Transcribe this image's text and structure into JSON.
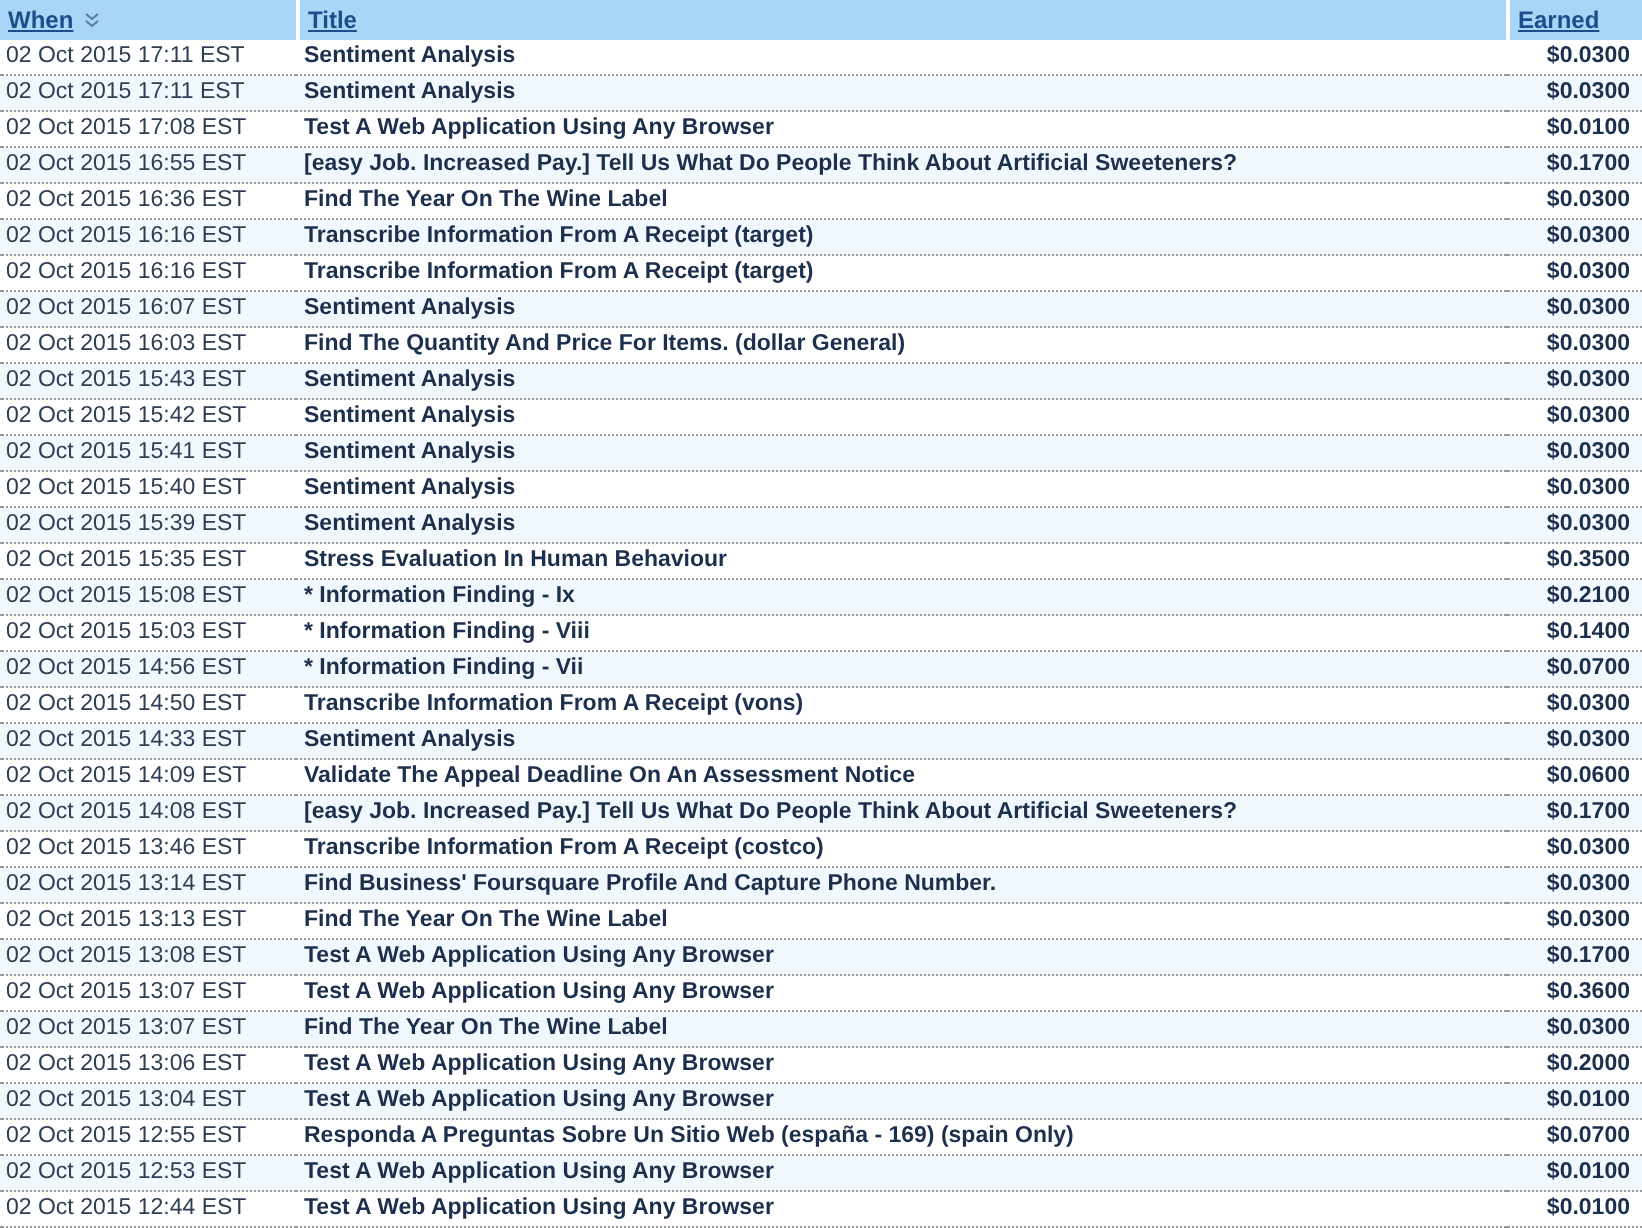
{
  "table": {
    "columns": [
      {
        "label": "When",
        "sorted": true
      },
      {
        "label": "Title",
        "sorted": false
      },
      {
        "label": "Earned",
        "sorted": false
      }
    ],
    "rows": [
      [
        "02 Oct 2015 17:11 EST",
        "Sentiment Analysis",
        "$0.0300"
      ],
      [
        "02 Oct 2015 17:11 EST",
        "Sentiment Analysis",
        "$0.0300"
      ],
      [
        "02 Oct 2015 17:08 EST",
        "Test A Web Application Using Any Browser",
        "$0.0100"
      ],
      [
        "02 Oct 2015 16:55 EST",
        "[easy Job. Increased Pay.] Tell Us What Do People Think About Artificial Sweeteners?",
        "$0.1700"
      ],
      [
        "02 Oct 2015 16:36 EST",
        "Find The Year On The Wine Label",
        "$0.0300"
      ],
      [
        "02 Oct 2015 16:16 EST",
        "Transcribe Information From A Receipt (target)",
        "$0.0300"
      ],
      [
        "02 Oct 2015 16:16 EST",
        "Transcribe Information From A Receipt (target)",
        "$0.0300"
      ],
      [
        "02 Oct 2015 16:07 EST",
        "Sentiment Analysis",
        "$0.0300"
      ],
      [
        "02 Oct 2015 16:03 EST",
        "Find The Quantity And Price For Items. (dollar General)",
        "$0.0300"
      ],
      [
        "02 Oct 2015 15:43 EST",
        "Sentiment Analysis",
        "$0.0300"
      ],
      [
        "02 Oct 2015 15:42 EST",
        "Sentiment Analysis",
        "$0.0300"
      ],
      [
        "02 Oct 2015 15:41 EST",
        "Sentiment Analysis",
        "$0.0300"
      ],
      [
        "02 Oct 2015 15:40 EST",
        "Sentiment Analysis",
        "$0.0300"
      ],
      [
        "02 Oct 2015 15:39 EST",
        "Sentiment Analysis",
        "$0.0300"
      ],
      [
        "02 Oct 2015 15:35 EST",
        "Stress Evaluation In Human Behaviour",
        "$0.3500"
      ],
      [
        "02 Oct 2015 15:08 EST",
        "* Information Finding - Ix",
        "$0.2100"
      ],
      [
        "02 Oct 2015 15:03 EST",
        "* Information Finding - Viii",
        "$0.1400"
      ],
      [
        "02 Oct 2015 14:56 EST",
        "* Information Finding - Vii",
        "$0.0700"
      ],
      [
        "02 Oct 2015 14:50 EST",
        "Transcribe Information From A Receipt (vons)",
        "$0.0300"
      ],
      [
        "02 Oct 2015 14:33 EST",
        "Sentiment Analysis",
        "$0.0300"
      ],
      [
        "02 Oct 2015 14:09 EST",
        "Validate The Appeal Deadline On An Assessment Notice",
        "$0.0600"
      ],
      [
        "02 Oct 2015 14:08 EST",
        "[easy Job. Increased Pay.] Tell Us What Do People Think About Artificial Sweeteners?",
        "$0.1700"
      ],
      [
        "02 Oct 2015 13:46 EST",
        "Transcribe Information From A Receipt (costco)",
        "$0.0300"
      ],
      [
        "02 Oct 2015 13:14 EST",
        "Find Business' Foursquare Profile And Capture Phone Number.",
        "$0.0300"
      ],
      [
        "02 Oct 2015 13:13 EST",
        "Find The Year On The Wine Label",
        "$0.0300"
      ],
      [
        "02 Oct 2015 13:08 EST",
        "Test A Web Application Using Any Browser",
        "$0.1700"
      ],
      [
        "02 Oct 2015 13:07 EST",
        "Test A Web Application Using Any Browser",
        "$0.3600"
      ],
      [
        "02 Oct 2015 13:07 EST",
        "Find The Year On The Wine Label",
        "$0.0300"
      ],
      [
        "02 Oct 2015 13:06 EST",
        "Test A Web Application Using Any Browser",
        "$0.2000"
      ],
      [
        "02 Oct 2015 13:04 EST",
        "Test A Web Application Using Any Browser",
        "$0.0100"
      ],
      [
        "02 Oct 2015 12:55 EST",
        "Responda A Preguntas Sobre Un Sitio Web (españa - 169) (spain Only)",
        "$0.0700"
      ],
      [
        "02 Oct 2015 12:53 EST",
        "Test A Web Application Using Any Browser",
        "$0.0100"
      ],
      [
        "02 Oct 2015 12:44 EST",
        "Test A Web Application Using Any Browser",
        "$0.0100"
      ]
    ]
  }
}
